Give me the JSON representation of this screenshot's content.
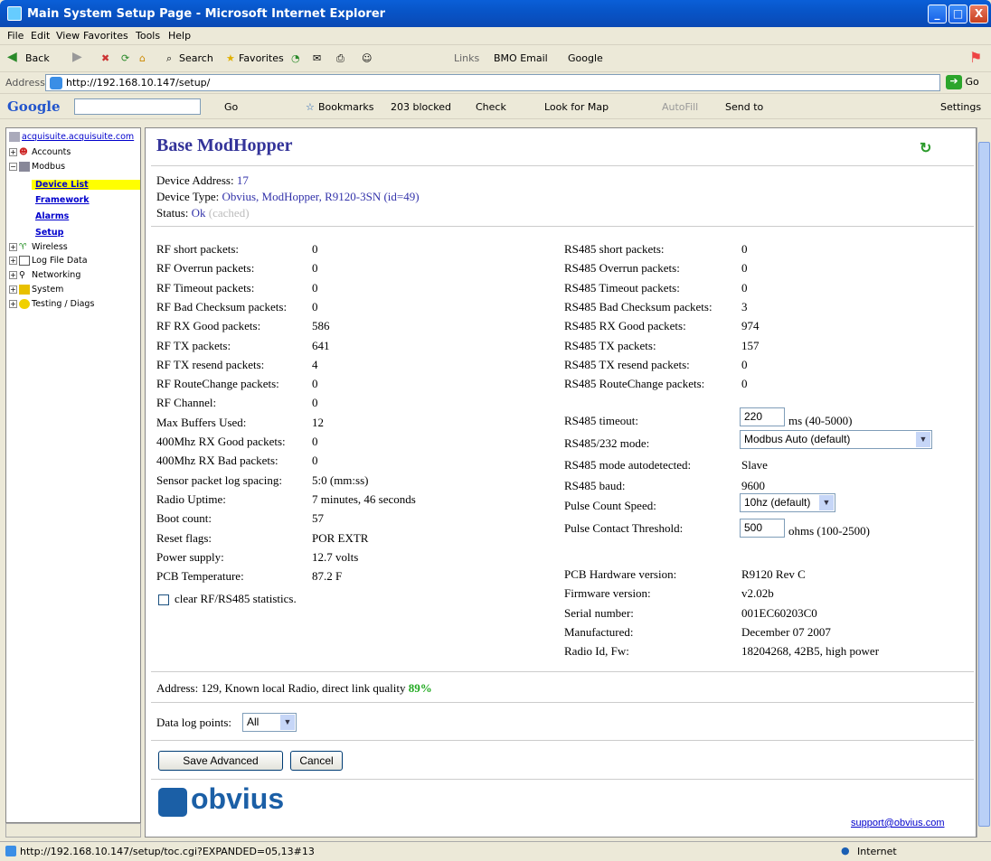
{
  "window": {
    "title": "Main System Setup Page - Microsoft Internet Explorer",
    "min": "_",
    "max": "□",
    "close": "X"
  },
  "menu": [
    "File",
    "Edit",
    "View",
    "Favorites",
    "Tools",
    "Help"
  ],
  "toolbar": {
    "back": "Back",
    "search": "Search",
    "favorites": "Favorites",
    "links": "Links",
    "bmo": "BMO Email",
    "google": "Google"
  },
  "address": {
    "label": "Address",
    "url": "http://192.168.10.147/setup/",
    "go": "Go"
  },
  "googlebar": {
    "logo": "Google",
    "go": "Go",
    "bookmarks": "Bookmarks",
    "blocked": "203 blocked",
    "check": "Check",
    "map": "Look for Map",
    "autofill": "AutoFill",
    "sendto": "Send to",
    "settings": "Settings"
  },
  "sidebar": {
    "root": "acquisuite.acquisuite.com",
    "items": [
      {
        "label": "Accounts"
      },
      {
        "label": "Modbus"
      },
      {
        "label": "Device List"
      },
      {
        "label": "Framework"
      },
      {
        "label": "Alarms"
      },
      {
        "label": "Setup"
      },
      {
        "label": "Wireless"
      },
      {
        "label": "Log File Data"
      },
      {
        "label": "Networking"
      },
      {
        "label": "System"
      },
      {
        "label": "Testing / Diags"
      }
    ]
  },
  "page": {
    "title": "Base ModHopper",
    "device_address_label": "Device Address:",
    "device_address": "17",
    "device_type_label": "Device Type:",
    "device_type": "Obvius, ModHopper, R9120-3SN (id=49)",
    "status_label": "Status:",
    "status": "Ok",
    "status_note": "(cached)"
  },
  "left_stats": [
    {
      "label": "RF short packets:",
      "value": "0"
    },
    {
      "label": "RF Overrun packets:",
      "value": "0"
    },
    {
      "label": "RF Timeout packets:",
      "value": "0"
    },
    {
      "label": "RF Bad Checksum packets:",
      "value": "0"
    },
    {
      "label": "RF RX Good packets:",
      "value": "586"
    },
    {
      "label": "RF TX packets:",
      "value": "641"
    },
    {
      "label": "RF TX resend packets:",
      "value": "4"
    },
    {
      "label": "RF RouteChange packets:",
      "value": "0"
    },
    {
      "label": "RF Channel:",
      "value": "0"
    },
    {
      "label": "Max Buffers Used:",
      "value": "12"
    },
    {
      "label": "400Mhz RX Good packets:",
      "value": "0"
    },
    {
      "label": "400Mhz RX Bad packets:",
      "value": "0"
    },
    {
      "label": "Sensor packet log spacing:",
      "value": "5:0 (mm:ss)"
    },
    {
      "label": "Radio Uptime:",
      "value": "7 minutes, 46 seconds"
    },
    {
      "label": "Boot count:",
      "value": "57"
    },
    {
      "label": "Reset flags:",
      "value": "POR EXTR"
    },
    {
      "label": "Power supply:",
      "value": "12.7 volts"
    },
    {
      "label": "PCB Temperature:",
      "value": "87.2 F"
    }
  ],
  "clear_label": "clear RF/RS485 statistics.",
  "right_stats": [
    {
      "label": "RS485 short packets:",
      "value": "0"
    },
    {
      "label": "RS485 Overrun packets:",
      "value": "0"
    },
    {
      "label": "RS485 Timeout packets:",
      "value": "0"
    },
    {
      "label": "RS485 Bad Checksum packets:",
      "value": "3"
    },
    {
      "label": "RS485 RX Good packets:",
      "value": "974"
    },
    {
      "label": "RS485 TX packets:",
      "value": "157"
    },
    {
      "label": "RS485 TX resend packets:",
      "value": "0"
    },
    {
      "label": "RS485 RouteChange packets:",
      "value": "0"
    }
  ],
  "rs485": {
    "timeout_label": "RS485 timeout:",
    "timeout_value": "220",
    "timeout_unit": "ms (40-5000)",
    "mode_label": "RS485/232 mode:",
    "mode_value": "Modbus Auto (default)",
    "autodetected_label": "RS485 mode autodetected:",
    "autodetected_value": "Slave",
    "baud_label": "RS485 baud:",
    "baud_value": "9600",
    "pulse_speed_label": "Pulse Count Speed:",
    "pulse_speed_value": "10hz (default)",
    "pulse_threshold_label": "Pulse Contact Threshold:",
    "pulse_threshold_value": "500",
    "pulse_threshold_unit": "ohms (100-2500)"
  },
  "hw": [
    {
      "label": "PCB Hardware version:",
      "value": "R9120 Rev C"
    },
    {
      "label": "Firmware version:",
      "value": "v2.02b"
    },
    {
      "label": "Serial number:",
      "value": "001EC60203C0"
    },
    {
      "label": "Manufactured:",
      "value": "December 07 2007"
    },
    {
      "label": "Radio Id, Fw:",
      "value": "18204268, 42B5, high power"
    }
  ],
  "link": {
    "text": "Address: 129, Known local Radio, direct link quality",
    "quality": "89%"
  },
  "datalog": {
    "label": "Data log points:",
    "value": "All"
  },
  "buttons": {
    "save": "Save Advanced",
    "cancel": "Cancel"
  },
  "footer": {
    "logo": "obvius",
    "support": "support@obvius.com"
  },
  "statusbar": {
    "url": "http://192.168.10.147/setup/toc.cgi?EXPANDED=05,13#13",
    "zone": "Internet"
  }
}
